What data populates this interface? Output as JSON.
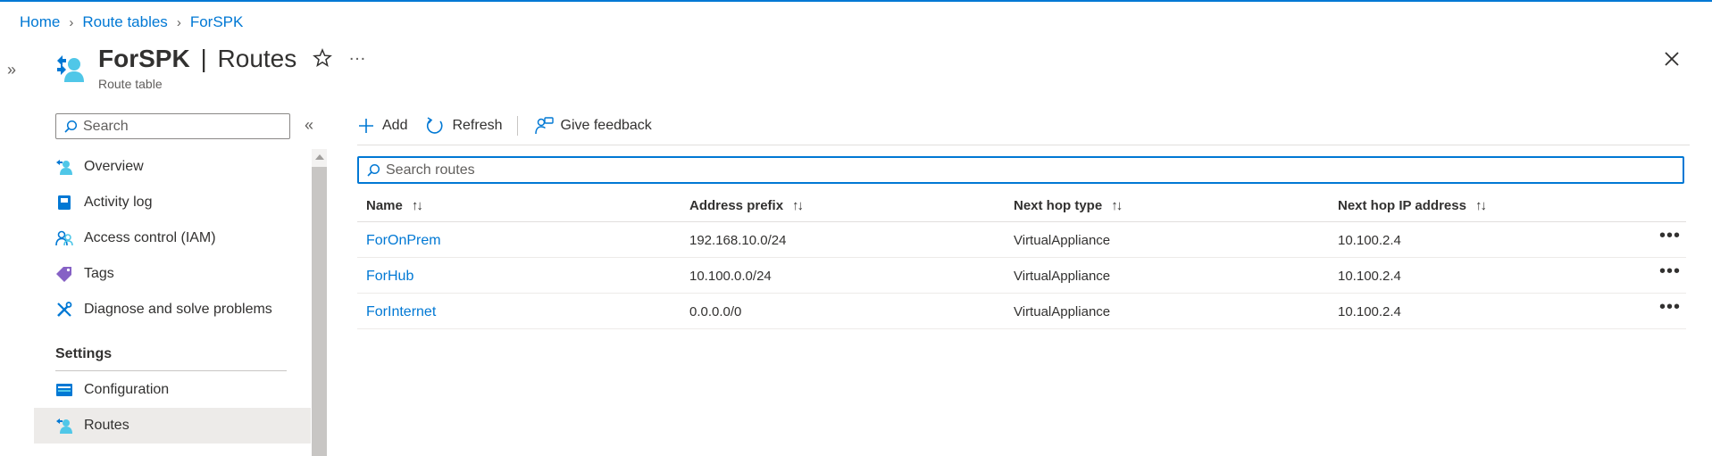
{
  "breadcrumb": [
    "Home",
    "Route tables",
    "ForSPK"
  ],
  "header": {
    "resource_name": "ForSPK",
    "separator": "|",
    "page": "Routes",
    "subtitle": "Route table"
  },
  "sidebar": {
    "search_placeholder": "Search",
    "items": [
      {
        "label": "Overview",
        "icon": "overview-icon"
      },
      {
        "label": "Activity log",
        "icon": "activity-log-icon"
      },
      {
        "label": "Access control (IAM)",
        "icon": "access-control-icon"
      },
      {
        "label": "Tags",
        "icon": "tag-icon"
      },
      {
        "label": "Diagnose and solve problems",
        "icon": "wrench-icon"
      }
    ],
    "section_title": "Settings",
    "settings_items": [
      {
        "label": "Configuration",
        "icon": "configuration-icon"
      },
      {
        "label": "Routes",
        "icon": "routes-icon",
        "selected": true
      }
    ]
  },
  "toolbar": {
    "add_label": "Add",
    "refresh_label": "Refresh",
    "feedback_label": "Give feedback"
  },
  "grid": {
    "search_placeholder": "Search routes",
    "columns": [
      "Name",
      "Address prefix",
      "Next hop type",
      "Next hop IP address"
    ],
    "rows": [
      {
        "name": "ForOnPrem",
        "prefix": "192.168.10.0/24",
        "hop_type": "VirtualAppliance",
        "hop_ip": "10.100.2.4"
      },
      {
        "name": "ForHub",
        "prefix": "10.100.0.0/24",
        "hop_type": "VirtualAppliance",
        "hop_ip": "10.100.2.4"
      },
      {
        "name": "ForInternet",
        "prefix": "0.0.0.0/0",
        "hop_type": "VirtualAppliance",
        "hop_ip": "10.100.2.4"
      }
    ]
  },
  "colors": {
    "accent": "#0078d4",
    "text": "#323130",
    "selected_bg": "#edebe9"
  }
}
